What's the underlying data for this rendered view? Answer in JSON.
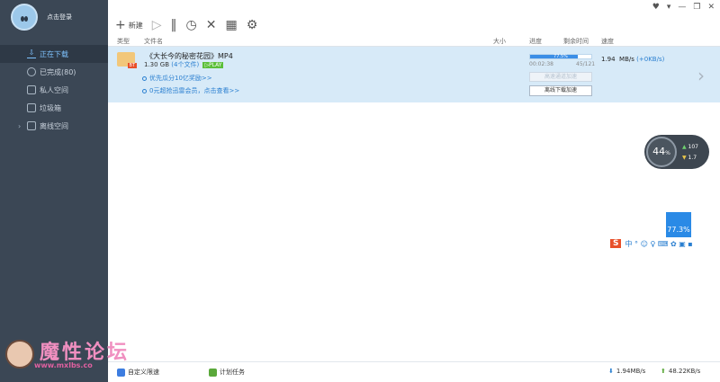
{
  "sidebar": {
    "login_label": "点击登录",
    "items": [
      {
        "label": "正在下载",
        "icon": "download-icon"
      },
      {
        "label": "已完成(80)",
        "icon": "check-circle-icon"
      },
      {
        "label": "私人空间",
        "icon": "lock-icon"
      },
      {
        "label": "垃圾箱",
        "icon": "trash-icon"
      },
      {
        "label": "离线空间",
        "icon": "cloud-icon"
      }
    ]
  },
  "window": {
    "controls": [
      "♥",
      "▾",
      "—",
      "❐",
      "✕"
    ]
  },
  "toolbar": {
    "new_label": "新建",
    "new_icon": "+",
    "play_icon": "▷",
    "pause_icon": "‖",
    "clock_icon": "◷",
    "delete_icon": "✕",
    "grid_icon": "▦",
    "settings_icon": "⚙"
  },
  "table": {
    "headers": {
      "type": "类型",
      "filename": "文件名",
      "size": "大小",
      "progress": "进度",
      "remaining": "剩余时间",
      "speed": "速度"
    },
    "rows": [
      {
        "badge": "BT",
        "name": "《大长今的秘密花园》MP4",
        "size": "1.30 GB",
        "file_count": "(4个文件)",
        "play": "▷PLAY",
        "link1": "优先瓜分10亿奖励>>",
        "link2": "0元超抢迅雷会员，点击查看>>",
        "progress_text": "77.5%",
        "progress_value": 0.775,
        "elapsed": "00:02:38",
        "pieces": "45/121",
        "accel_button": "高速通道加速",
        "offline_button": "离线下载加速",
        "speed": "1.94",
        "speed_unit": "MB/s",
        "speed_extra": "(+0KB/s)"
      }
    ]
  },
  "floating": {
    "gauge_value": "44",
    "gauge_unit": "%",
    "up_speed": "107",
    "down_speed": "1.7",
    "up_arrow": "▲",
    "down_arrow": "▼",
    "blue_box": "77.3%",
    "ime_logo": "S",
    "ime_text": "中 ° ☺ ♀ ⌨ ✿ ▣ ▪"
  },
  "watermark": {
    "text": "魔性论坛",
    "url": "www.mxlbs.co"
  },
  "statusbar": {
    "custom_speed": "自定义限速",
    "schedule": "计划任务",
    "down_arrow": "⬇",
    "down_speed": "1.94MB/s",
    "up_arrow": "⬆",
    "up_speed": "48.22KB/s"
  }
}
